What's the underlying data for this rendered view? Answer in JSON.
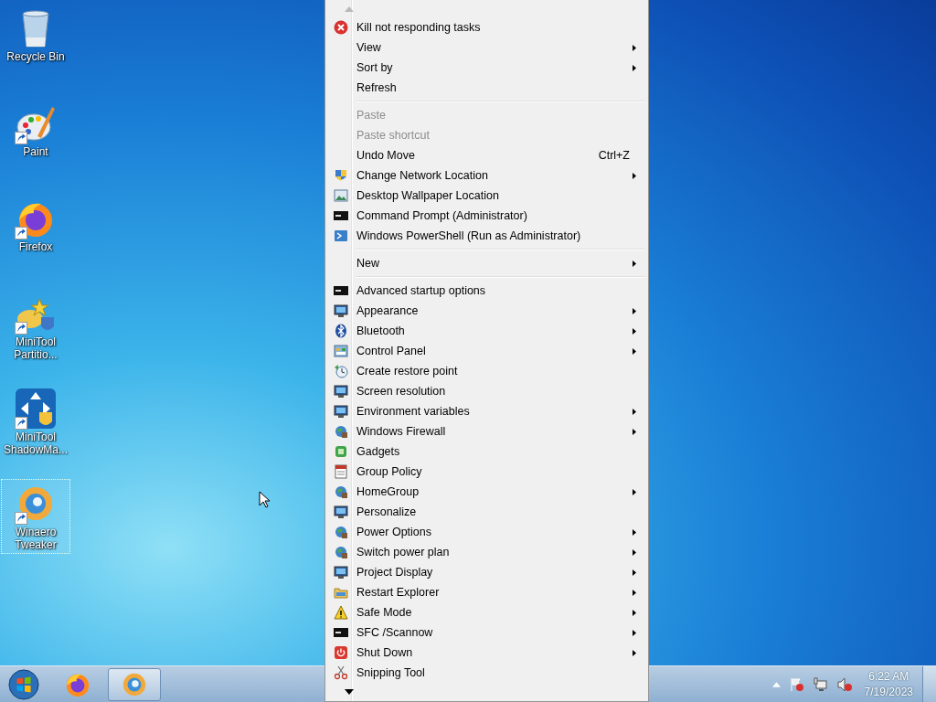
{
  "desktop_icons": [
    {
      "label": "Recycle Bin",
      "shortcut": false,
      "selected": false
    },
    {
      "label": "Paint",
      "shortcut": true,
      "selected": false
    },
    {
      "label": "Firefox",
      "shortcut": true,
      "selected": false
    },
    {
      "label": "MiniTool Partitio...",
      "shortcut": true,
      "selected": false
    },
    {
      "label": "MiniTool ShadowMa...",
      "shortcut": true,
      "selected": false
    },
    {
      "label": "Winaero Tweaker",
      "shortcut": true,
      "selected": true
    }
  ],
  "context_menu": {
    "sections": [
      {
        "items": [
          {
            "label": "Kill not responding tasks",
            "submenu": false,
            "disabled": false
          },
          {
            "label": "View",
            "submenu": true,
            "disabled": false
          },
          {
            "label": "Sort by",
            "submenu": true,
            "disabled": false
          },
          {
            "label": "Refresh",
            "submenu": false,
            "disabled": false
          }
        ]
      },
      {
        "items": [
          {
            "label": "Paste",
            "submenu": false,
            "disabled": true
          },
          {
            "label": "Paste shortcut",
            "submenu": false,
            "disabled": true
          },
          {
            "label": "Undo Move",
            "submenu": false,
            "disabled": false,
            "shortcut": "Ctrl+Z"
          },
          {
            "label": "Change Network Location",
            "submenu": true,
            "disabled": false
          },
          {
            "label": "Desktop Wallpaper Location",
            "submenu": false,
            "disabled": false
          },
          {
            "label": "Command Prompt (Administrator)",
            "submenu": false,
            "disabled": false
          },
          {
            "label": "Windows PowerShell (Run as Administrator)",
            "submenu": false,
            "disabled": false
          }
        ]
      },
      {
        "items": [
          {
            "label": "New",
            "submenu": true,
            "disabled": false
          }
        ]
      },
      {
        "items": [
          {
            "label": "Advanced startup options",
            "submenu": false,
            "disabled": false
          },
          {
            "label": "Appearance",
            "submenu": true,
            "disabled": false
          },
          {
            "label": "Bluetooth",
            "submenu": true,
            "disabled": false
          },
          {
            "label": "Control Panel",
            "submenu": true,
            "disabled": false
          },
          {
            "label": "Create restore point",
            "submenu": false,
            "disabled": false
          },
          {
            "label": "Screen resolution",
            "submenu": false,
            "disabled": false
          },
          {
            "label": "Environment variables",
            "submenu": true,
            "disabled": false
          },
          {
            "label": "Windows Firewall",
            "submenu": true,
            "disabled": false
          },
          {
            "label": "Gadgets",
            "submenu": false,
            "disabled": false
          },
          {
            "label": "Group Policy",
            "submenu": false,
            "disabled": false
          },
          {
            "label": "HomeGroup",
            "submenu": true,
            "disabled": false
          },
          {
            "label": "Personalize",
            "submenu": false,
            "disabled": false
          },
          {
            "label": "Power Options",
            "submenu": true,
            "disabled": false
          },
          {
            "label": "Switch power plan",
            "submenu": true,
            "disabled": false
          },
          {
            "label": "Project Display",
            "submenu": true,
            "disabled": false
          },
          {
            "label": "Restart Explorer",
            "submenu": true,
            "disabled": false
          },
          {
            "label": "Safe Mode",
            "submenu": true,
            "disabled": false
          },
          {
            "label": "SFC /Scannow",
            "submenu": true,
            "disabled": false
          },
          {
            "label": "Shut Down",
            "submenu": true,
            "disabled": false
          },
          {
            "label": "Snipping Tool",
            "submenu": false,
            "disabled": false
          }
        ]
      }
    ]
  },
  "taskbar": {
    "buttons": [
      {
        "selected": false
      },
      {
        "selected": true
      }
    ],
    "clock": {
      "time": "6:22 AM",
      "date": "7/19/2023"
    }
  }
}
